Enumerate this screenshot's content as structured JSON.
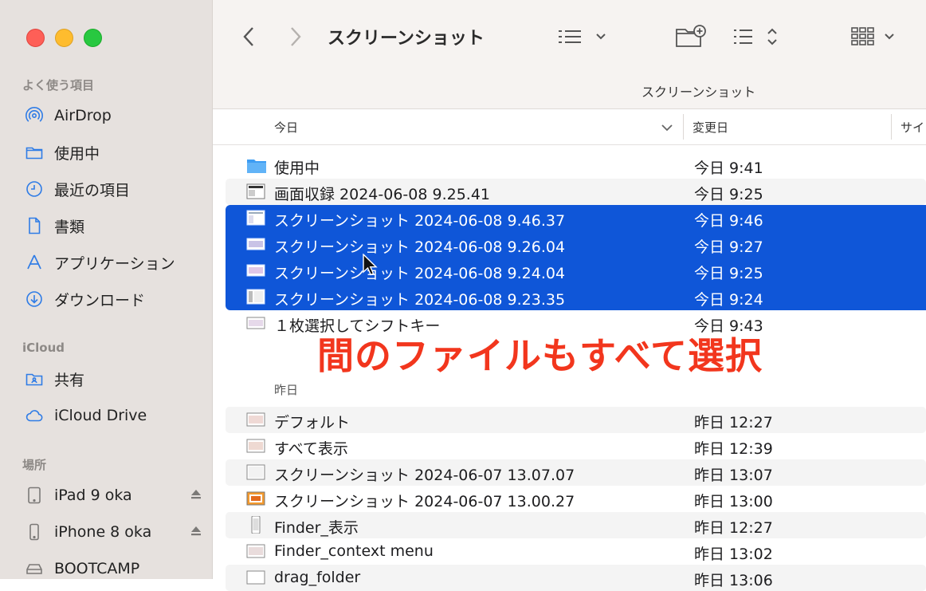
{
  "sidebar": {
    "sections": [
      {
        "title": "よく使う項目",
        "items": [
          {
            "label": "AirDrop",
            "icon": "airdrop-icon"
          },
          {
            "label": "使用中",
            "icon": "folder-icon"
          },
          {
            "label": "最近の項目",
            "icon": "clock-icon"
          },
          {
            "label": "書類",
            "icon": "document-icon"
          },
          {
            "label": "アプリケーション",
            "icon": "applications-icon"
          },
          {
            "label": "ダウンロード",
            "icon": "download-icon"
          }
        ]
      },
      {
        "title": "iCloud",
        "items": [
          {
            "label": "共有",
            "icon": "shared-folder-icon"
          },
          {
            "label": "iCloud Drive",
            "icon": "cloud-icon"
          }
        ]
      },
      {
        "title": "場所",
        "items": [
          {
            "label": "iPad 9 oka",
            "icon": "ipad-icon"
          },
          {
            "label": "iPhone 8 oka",
            "icon": "iphone-icon"
          },
          {
            "label": "BOOTCAMP",
            "icon": "disk-icon"
          }
        ]
      }
    ]
  },
  "toolbar": {
    "title": "スクリーンショット"
  },
  "pathbar": {
    "text": "スクリーンショット"
  },
  "columns": {
    "name": "今日",
    "date": "変更日",
    "size": "サイ"
  },
  "groups": {
    "today": "今日",
    "yesterday": "昨日"
  },
  "rows_today": [
    {
      "name": "使用中",
      "date": "今日 9:41",
      "kind": "folder",
      "selected": false
    },
    {
      "name": "画面収録 2024-06-08 9.25.41",
      "date": "今日 9:25",
      "kind": "video",
      "selected": false
    },
    {
      "name": "スクリーンショット 2024-06-08 9.46.37",
      "date": "今日 9:46",
      "kind": "image",
      "selected": true
    },
    {
      "name": "スクリーンショット 2024-06-08 9.26.04",
      "date": "今日 9:27",
      "kind": "image",
      "selected": true
    },
    {
      "name": "スクリーンショット 2024-06-08 9.24.04",
      "date": "今日 9:25",
      "kind": "image",
      "selected": true
    },
    {
      "name": "スクリーンショット 2024-06-08 9.23.35",
      "date": "今日 9:24",
      "kind": "image",
      "selected": true
    },
    {
      "name": "１枚選択してシフトキー",
      "date": "今日 9:43",
      "kind": "image",
      "selected": false
    }
  ],
  "rows_yesterday": [
    {
      "name": "デフォルト",
      "date": "昨日 12:27",
      "kind": "image"
    },
    {
      "name": "すべて表示",
      "date": "昨日 12:39",
      "kind": "image"
    },
    {
      "name": "スクリーンショット 2024-06-07 13.07.07",
      "date": "昨日 13:07",
      "kind": "image"
    },
    {
      "name": "スクリーンショット 2024-06-07 13.00.27",
      "date": "昨日 13:00",
      "kind": "image-orange"
    },
    {
      "name": "Finder_表示",
      "date": "昨日 12:27",
      "kind": "phone-image"
    },
    {
      "name": "Finder_context menu",
      "date": "昨日 13:02",
      "kind": "image"
    },
    {
      "name": "drag_folder",
      "date": "昨日 13:06",
      "kind": "image"
    }
  ],
  "annotation": {
    "text": "間のファイルもすべて選択",
    "color": "#f2361d"
  },
  "colors": {
    "selection": "#0f56d8",
    "sidebar_bg": "#e6e1de",
    "accent_icon": "#2f7ce6"
  }
}
